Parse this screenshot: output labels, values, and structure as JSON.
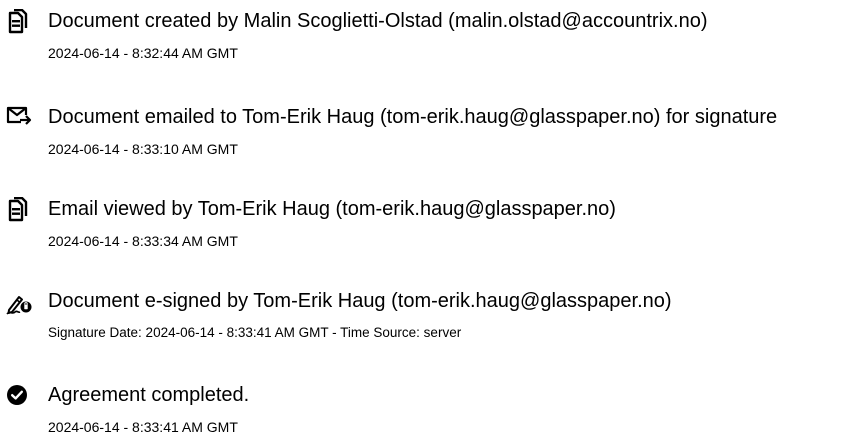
{
  "events": [
    {
      "icon": "document-icon",
      "title": "Document created by Malin Scoglietti-Olstad (malin.olstad@accountrix.no)",
      "meta": "2024-06-14 - 8:32:44 AM GMT"
    },
    {
      "icon": "email-send-icon",
      "title": "Document emailed to Tom-Erik Haug (tom-erik.haug@glasspaper.no) for signature",
      "meta": "2024-06-14 - 8:33:10 AM GMT"
    },
    {
      "icon": "document-icon",
      "title": "Email viewed by Tom-Erik Haug (tom-erik.haug@glasspaper.no)",
      "meta": "2024-06-14 - 8:33:34 AM GMT"
    },
    {
      "icon": "signature-pen-icon",
      "title": "Document e-signed by Tom-Erik Haug (tom-erik.haug@glasspaper.no)",
      "meta": "Signature Date: 2024-06-14 - 8:33:41 AM GMT - Time Source: server"
    },
    {
      "icon": "check-circle-icon",
      "title": "Agreement completed.",
      "meta": "2024-06-14 - 8:33:41 AM GMT"
    }
  ]
}
